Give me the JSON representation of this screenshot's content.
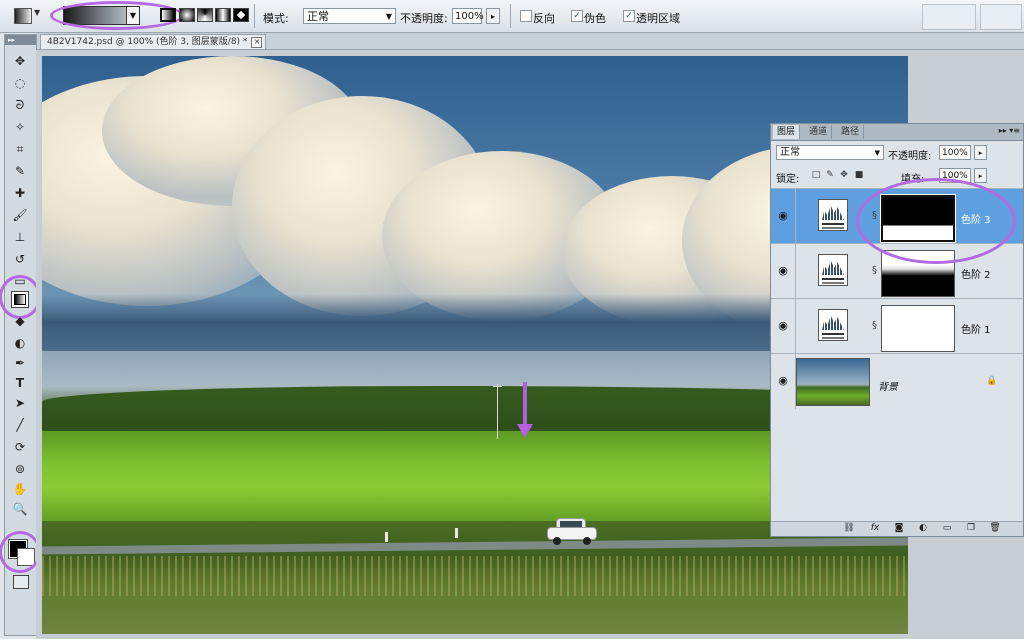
{
  "options_bar": {
    "mode_label": "模式:",
    "mode_value": "正常",
    "opacity_label": "不透明度:",
    "opacity_value": "100%",
    "reverse_label": "反向",
    "dither_label": "伪色",
    "transparency_label": "透明区域",
    "checkbox_checked": "✓"
  },
  "document": {
    "tab_title": "4B2V1742.psd @ 100% (色阶 3, 图层蒙版/8) *",
    "close": "×"
  },
  "layers_panel": {
    "tabs": [
      "图层",
      "通道",
      "路径"
    ],
    "blend_mode": "正常",
    "opacity_label": "不透明度:",
    "opacity_value": "100%",
    "lock_label": "锁定:",
    "fill_label": "填充:",
    "fill_value": "100%",
    "layers": [
      {
        "name": "色阶 3",
        "selected": true
      },
      {
        "name": "色阶 2",
        "selected": false
      },
      {
        "name": "色阶 1",
        "selected": false
      },
      {
        "name": "背景",
        "selected": false
      }
    ]
  },
  "colors": {
    "annotation": "#b46ae0",
    "selected_layer": "#5ea0df",
    "foreground": "#000000",
    "background": "#ffffff"
  }
}
